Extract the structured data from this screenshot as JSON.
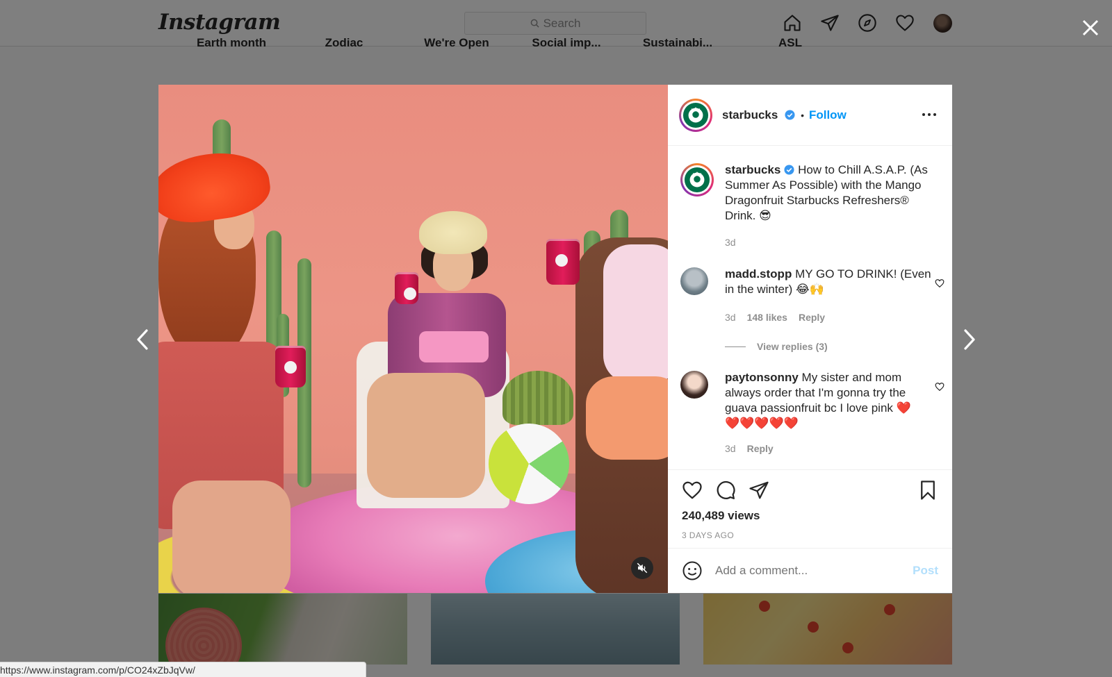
{
  "nav": {
    "logo": "Instagram",
    "search_placeholder": "Search",
    "icons": [
      "home-icon",
      "direct-icon",
      "explore-icon",
      "activity-heart-icon",
      "profile-avatar"
    ]
  },
  "highlights": [
    "Earth month",
    "Zodiac",
    "We're Open",
    "Social imp...",
    "Sustainabi...",
    "ASL"
  ],
  "post": {
    "header": {
      "username": "starbucks",
      "follow_label": "Follow"
    },
    "caption": {
      "username": "starbucks",
      "text": "How to Chill A.S.A.P. (As Summer As Possible) with the Mango Dragonfruit Starbucks Refreshers® Drink. 😎",
      "time": "3d"
    },
    "comments": [
      {
        "username": "madd.stopp",
        "text": "MY GO TO DRINK! (Even in the winter) 😂🙌",
        "time": "3d",
        "likes": "148 likes",
        "reply_label": "Reply",
        "view_replies": "View replies (3)"
      },
      {
        "username": "paytonsonny",
        "text": "My sister and mom always order that I'm gonna try the guava passionfruit bc I love pink ❤️❤️❤️❤️❤️❤️",
        "time": "3d",
        "reply_label": "Reply"
      }
    ],
    "views": "240,489 views",
    "posted_ago": "3 DAYS AGO",
    "add_comment_placeholder": "Add a comment...",
    "post_label": "Post"
  },
  "status_url": "https://www.instagram.com/p/CO24xZbJqVw/",
  "colors": {
    "accent": "#0095f6",
    "post_disabled": "#b2dffc",
    "verified": "#3897f0"
  }
}
